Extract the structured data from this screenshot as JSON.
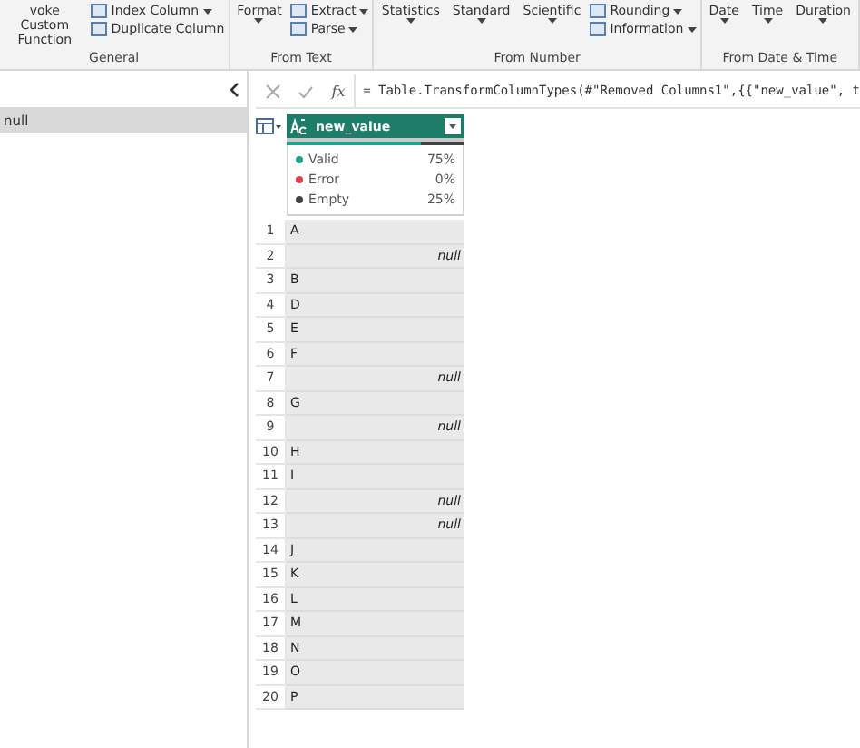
{
  "ribbon": {
    "groups": [
      {
        "label": "General",
        "buttons": [
          {
            "kind": "large",
            "label": "voke Custom Function"
          },
          {
            "kind": "small",
            "label": "Index Column",
            "dropdown": true
          },
          {
            "kind": "small",
            "label": "Duplicate Column",
            "dropdown": false
          }
        ]
      },
      {
        "label": "From Text",
        "buttons": [
          {
            "kind": "large",
            "label": "Format",
            "dropdown": true
          },
          {
            "kind": "small",
            "label": "Extract",
            "dropdown": true
          },
          {
            "kind": "small",
            "label": "Parse",
            "dropdown": true
          }
        ]
      },
      {
        "label": "From Number",
        "buttons": [
          {
            "kind": "large",
            "label": "Statistics",
            "dropdown": true
          },
          {
            "kind": "large",
            "label": "Standard",
            "dropdown": true
          },
          {
            "kind": "large",
            "label": "Scientific",
            "dropdown": true
          },
          {
            "kind": "small",
            "label": "Rounding",
            "dropdown": true
          },
          {
            "kind": "small",
            "label": "Information",
            "dropdown": true
          }
        ]
      },
      {
        "label": "From Date & Time",
        "buttons": [
          {
            "kind": "large",
            "label": "Date",
            "dropdown": true
          },
          {
            "kind": "large",
            "label": "Time",
            "dropdown": true
          },
          {
            "kind": "large",
            "label": "Duration",
            "dropdown": true
          }
        ]
      }
    ]
  },
  "queries": {
    "items": [
      {
        "label": "null",
        "selected": true
      }
    ]
  },
  "formula_bar": {
    "fx": "fx",
    "formula": "= Table.TransformColumnTypes(#\"Removed Columns1\",{{\"new_value\", t"
  },
  "table": {
    "column": {
      "name": "new_value",
      "quality": [
        {
          "label": "Valid",
          "value": "75%",
          "color": "#1aa68e"
        },
        {
          "label": "Error",
          "value": "0%",
          "color": "#e0404a"
        },
        {
          "label": "Empty",
          "value": "25%",
          "color": "#444444"
        }
      ]
    },
    "rows": [
      {
        "number": "1",
        "value": "A",
        "null": false
      },
      {
        "number": "2",
        "value": "null",
        "null": true
      },
      {
        "number": "3",
        "value": "B",
        "null": false
      },
      {
        "number": "4",
        "value": "D",
        "null": false
      },
      {
        "number": "5",
        "value": "E",
        "null": false
      },
      {
        "number": "6",
        "value": "F",
        "null": false
      },
      {
        "number": "7",
        "value": "null",
        "null": true
      },
      {
        "number": "8",
        "value": "G",
        "null": false
      },
      {
        "number": "9",
        "value": "null",
        "null": true
      },
      {
        "number": "10",
        "value": "H",
        "null": false
      },
      {
        "number": "11",
        "value": "I",
        "null": false
      },
      {
        "number": "12",
        "value": "null",
        "null": true
      },
      {
        "number": "13",
        "value": "null",
        "null": true
      },
      {
        "number": "14",
        "value": "J",
        "null": false
      },
      {
        "number": "15",
        "value": "K",
        "null": false
      },
      {
        "number": "16",
        "value": "L",
        "null": false
      },
      {
        "number": "17",
        "value": "M",
        "null": false
      },
      {
        "number": "18",
        "value": "N",
        "null": false
      },
      {
        "number": "19",
        "value": "O",
        "null": false
      },
      {
        "number": "20",
        "value": "P",
        "null": false
      }
    ]
  }
}
